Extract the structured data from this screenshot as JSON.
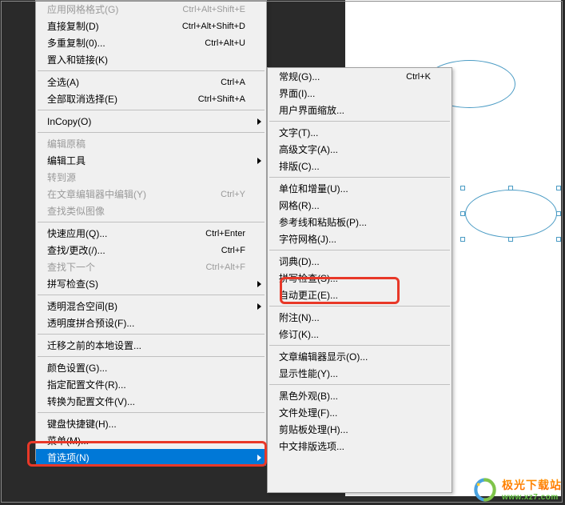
{
  "menu_main": {
    "group0": [
      {
        "label": "应用网格格式(G)",
        "shortcut": "Ctrl+Alt+Shift+E",
        "disabled": true,
        "arrow": false
      },
      {
        "label": "直接复制(D)",
        "shortcut": "Ctrl+Alt+Shift+D",
        "disabled": false,
        "arrow": false
      },
      {
        "label": "多重复制(0)...",
        "shortcut": "Ctrl+Alt+U",
        "disabled": false,
        "arrow": false
      },
      {
        "label": "置入和链接(K)",
        "shortcut": "",
        "disabled": false,
        "arrow": false
      }
    ],
    "group1": [
      {
        "label": "全选(A)",
        "shortcut": "Ctrl+A",
        "disabled": false,
        "arrow": false
      },
      {
        "label": "全部取消选择(E)",
        "shortcut": "Ctrl+Shift+A",
        "disabled": false,
        "arrow": false
      }
    ],
    "group2": [
      {
        "label": "InCopy(O)",
        "shortcut": "",
        "disabled": false,
        "arrow": true
      }
    ],
    "group3": [
      {
        "label": "编辑原稿",
        "shortcut": "",
        "disabled": true,
        "arrow": false
      },
      {
        "label": "编辑工具",
        "shortcut": "",
        "disabled": false,
        "arrow": true
      },
      {
        "label": "转到源",
        "shortcut": "",
        "disabled": true,
        "arrow": false
      },
      {
        "label": "在文章编辑器中编辑(Y)",
        "shortcut": "Ctrl+Y",
        "disabled": true,
        "arrow": false
      },
      {
        "label": "查找类似图像",
        "shortcut": "",
        "disabled": true,
        "arrow": false
      }
    ],
    "group4": [
      {
        "label": "快速应用(Q)...",
        "shortcut": "Ctrl+Enter",
        "disabled": false,
        "arrow": false
      },
      {
        "label": "查找/更改(/)...",
        "shortcut": "Ctrl+F",
        "disabled": false,
        "arrow": false
      },
      {
        "label": "查找下一个",
        "shortcut": "Ctrl+Alt+F",
        "disabled": true,
        "arrow": false
      },
      {
        "label": "拼写检查(S)",
        "shortcut": "",
        "disabled": false,
        "arrow": true
      }
    ],
    "group5": [
      {
        "label": "透明混合空间(B)",
        "shortcut": "",
        "disabled": false,
        "arrow": true
      },
      {
        "label": "透明度拼合预设(F)...",
        "shortcut": "",
        "disabled": false,
        "arrow": false
      }
    ],
    "group6": [
      {
        "label": "迁移之前的本地设置...",
        "shortcut": "",
        "disabled": false,
        "arrow": false
      }
    ],
    "group7": [
      {
        "label": "颜色设置(G)...",
        "shortcut": "",
        "disabled": false,
        "arrow": false
      },
      {
        "label": "指定配置文件(R)...",
        "shortcut": "",
        "disabled": false,
        "arrow": false
      },
      {
        "label": "转换为配置文件(V)...",
        "shortcut": "",
        "disabled": false,
        "arrow": false
      }
    ],
    "group8": [
      {
        "label": "键盘快捷键(H)...",
        "shortcut": "",
        "disabled": false,
        "arrow": false
      },
      {
        "label": "菜单(M)...",
        "shortcut": "",
        "disabled": false,
        "arrow": false
      },
      {
        "label": "首选项(N)",
        "shortcut": "",
        "disabled": false,
        "arrow": true,
        "selected": true
      }
    ]
  },
  "menu_sub": {
    "group0": [
      {
        "label": "常规(G)...",
        "shortcut": "Ctrl+K"
      },
      {
        "label": "界面(I)...",
        "shortcut": ""
      },
      {
        "label": "用户界面缩放...",
        "shortcut": ""
      }
    ],
    "group1": [
      {
        "label": "文字(T)...",
        "shortcut": ""
      },
      {
        "label": "高级文字(A)...",
        "shortcut": ""
      },
      {
        "label": "排版(C)...",
        "shortcut": ""
      }
    ],
    "group2": [
      {
        "label": "单位和增量(U)...",
        "shortcut": ""
      },
      {
        "label": "网格(R)...",
        "shortcut": ""
      },
      {
        "label": "参考线和粘贴板(P)...",
        "shortcut": ""
      },
      {
        "label": "字符网格(J)...",
        "shortcut": ""
      }
    ],
    "group3": [
      {
        "label": "词典(D)...",
        "shortcut": ""
      },
      {
        "label": "拼写检查(S)...",
        "shortcut": ""
      },
      {
        "label": "自动更正(E)...",
        "shortcut": ""
      }
    ],
    "group4": [
      {
        "label": "附注(N)...",
        "shortcut": ""
      },
      {
        "label": "修订(K)...",
        "shortcut": ""
      }
    ],
    "group5": [
      {
        "label": "文章编辑器显示(O)...",
        "shortcut": ""
      },
      {
        "label": "显示性能(Y)...",
        "shortcut": ""
      }
    ],
    "group6": [
      {
        "label": "黑色外观(B)...",
        "shortcut": ""
      },
      {
        "label": "文件处理(F)...",
        "shortcut": ""
      },
      {
        "label": "剪贴板处理(H)...",
        "shortcut": ""
      },
      {
        "label": "中文排版选项...",
        "shortcut": ""
      }
    ]
  },
  "watermark": {
    "cn": "极光下载站",
    "url": "www.xz7.com"
  }
}
